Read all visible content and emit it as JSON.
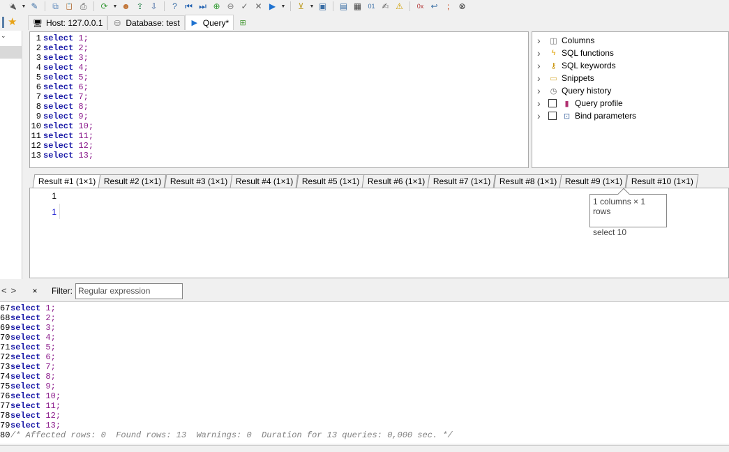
{
  "toolbar": {
    "icons": [
      "connection-icon",
      "edit-icon",
      "copy-icon",
      "paste-icon",
      "print-icon",
      "refresh-icon",
      "user-icon",
      "export-icon",
      "import-icon",
      "help-icon",
      "first-icon",
      "last-icon",
      "add-icon",
      "remove-icon",
      "check-icon",
      "cancel-icon",
      "run-icon",
      "filter-icon",
      "save-icon",
      "save-as-icon",
      "grid-icon",
      "binary-icon",
      "edit-query-icon",
      "warning-icon",
      "hex-icon",
      "wrap-icon",
      "semicolon-icon",
      "close-icon"
    ]
  },
  "main_tabs": [
    {
      "label": "Host: 127.0.0.1",
      "icon": "host-icon"
    },
    {
      "label": "Database: test",
      "icon": "database-icon"
    },
    {
      "label": "Query*",
      "icon": "play-icon"
    }
  ],
  "editor": {
    "lines": [
      {
        "n": "1",
        "kw": "select",
        "val": "1"
      },
      {
        "n": "2",
        "kw": "select",
        "val": "2"
      },
      {
        "n": "3",
        "kw": "select",
        "val": "3"
      },
      {
        "n": "4",
        "kw": "select",
        "val": "4"
      },
      {
        "n": "5",
        "kw": "select",
        "val": "5"
      },
      {
        "n": "6",
        "kw": "select",
        "val": "6"
      },
      {
        "n": "7",
        "kw": "select",
        "val": "7"
      },
      {
        "n": "8",
        "kw": "select",
        "val": "8"
      },
      {
        "n": "9",
        "kw": "select",
        "val": "9"
      },
      {
        "n": "10",
        "kw": "select",
        "val": "10"
      },
      {
        "n": "11",
        "kw": "select",
        "val": "11"
      },
      {
        "n": "12",
        "kw": "select",
        "val": "12"
      },
      {
        "n": "13",
        "kw": "select",
        "val": "13"
      }
    ]
  },
  "helpers": [
    {
      "label": "Columns",
      "icon": "columns-icon",
      "checkbox": false
    },
    {
      "label": "SQL functions",
      "icon": "lightning-icon",
      "checkbox": false
    },
    {
      "label": "SQL keywords",
      "icon": "key-icon",
      "checkbox": false
    },
    {
      "label": "Snippets",
      "icon": "folder-icon",
      "checkbox": false
    },
    {
      "label": "Query history",
      "icon": "clock-icon",
      "checkbox": false
    },
    {
      "label": "Query profile",
      "icon": "bar-chart-icon",
      "checkbox": true
    },
    {
      "label": "Bind parameters",
      "icon": "bind-icon",
      "checkbox": true
    }
  ],
  "result_tabs": [
    "Result #1 (1×1)",
    "Result #2 (1×1)",
    "Result #3 (1×1)",
    "Result #4 (1×1)",
    "Result #5 (1×1)",
    "Result #6 (1×1)",
    "Result #7 (1×1)",
    "Result #8 (1×1)",
    "Result #9 (1×1)",
    "Result #10 (1×1)"
  ],
  "grid": {
    "header": "1",
    "cell": "1"
  },
  "tooltip": {
    "line1": "1 columns × 1 rows",
    "line2": "select 10"
  },
  "filter": {
    "close": "×",
    "label": "Filter:",
    "placeholder": "Regular expression",
    "value": ""
  },
  "nav": {
    "left": "<",
    "right": ">"
  },
  "log": {
    "lines": [
      {
        "n": "67",
        "kw": "select",
        "val": "1"
      },
      {
        "n": "68",
        "kw": "select",
        "val": "2"
      },
      {
        "n": "69",
        "kw": "select",
        "val": "3"
      },
      {
        "n": "70",
        "kw": "select",
        "val": "4"
      },
      {
        "n": "71",
        "kw": "select",
        "val": "5"
      },
      {
        "n": "72",
        "kw": "select",
        "val": "6"
      },
      {
        "n": "73",
        "kw": "select",
        "val": "7"
      },
      {
        "n": "74",
        "kw": "select",
        "val": "8"
      },
      {
        "n": "75",
        "kw": "select",
        "val": "9"
      },
      {
        "n": "76",
        "kw": "select",
        "val": "10"
      },
      {
        "n": "77",
        "kw": "select",
        "val": "11"
      },
      {
        "n": "78",
        "kw": "select",
        "val": "12"
      },
      {
        "n": "79",
        "kw": "select",
        "val": "13"
      }
    ],
    "summary_n": "80",
    "summary": "/* Affected rows: 0  Found rows: 13  Warnings: 0  Duration for 13 queries: 0,000 sec. */"
  }
}
